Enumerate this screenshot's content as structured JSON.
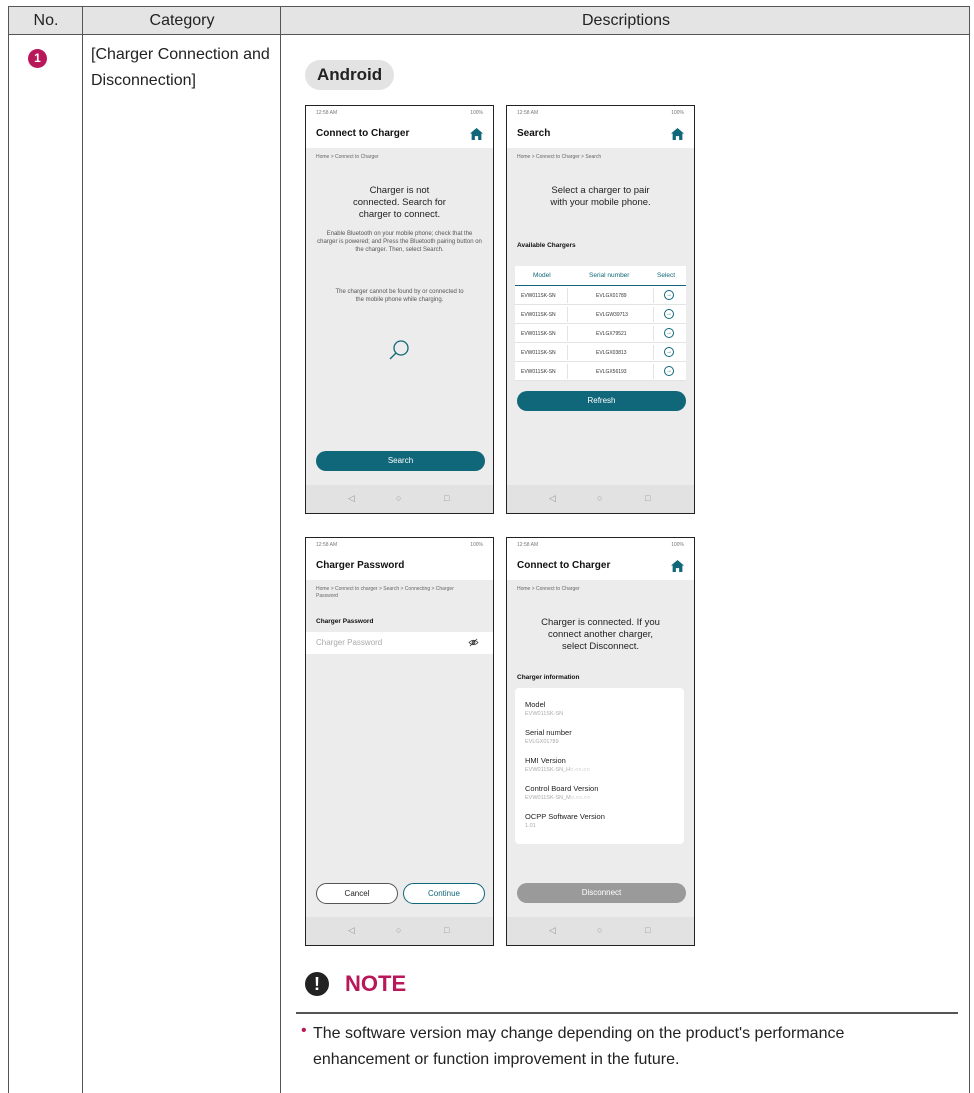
{
  "header": {
    "no": "No.",
    "category": "Category",
    "descriptions": "Descriptions"
  },
  "row": {
    "number": "1",
    "category": "[Charger Connection and Disconnection]",
    "platform": "Android"
  },
  "status": {
    "time": "12:58 AM",
    "battery": "100%"
  },
  "screens": {
    "connect": {
      "title": "Connect to Charger",
      "crumb": "Home > Connect to Charger",
      "message": "Charger is not connected. Search for charger to connect.",
      "instructions": "Enable Bluetooth on your mobile phone; check that the charger is powered; and Press the Bluetooth pairing button on the charger. Then, select Search.",
      "warning": "The charger cannot be found by or connected to the mobile phone while charging.",
      "button": "Search"
    },
    "search": {
      "title": "Search",
      "crumb": "Home > Connect to Charger > Search",
      "message": "Select a charger to pair with your mobile phone.",
      "section": "Available Chargers",
      "columns": [
        "Model",
        "Serial number",
        "Select"
      ],
      "rows": [
        {
          "model": "EVW011SK-SN",
          "serial": "EVLGX01789"
        },
        {
          "model": "EVW011SK-SN",
          "serial": "EVLGW39713"
        },
        {
          "model": "EVW011SK-SN",
          "serial": "EVLGX79521"
        },
        {
          "model": "EVW011SK-SN",
          "serial": "EVLGX03813"
        },
        {
          "model": "EVW011SK-SN",
          "serial": "EVLGX56193"
        }
      ],
      "button": "Refresh"
    },
    "password": {
      "title": "Charger Password",
      "crumb": "Home > Connect to charger > Search > Connecting > Charger Password",
      "section": "Charger Password",
      "placeholder": "Charger Password",
      "cancel": "Cancel",
      "continue": "Continue"
    },
    "connected": {
      "title": "Connect to Charger",
      "crumb": "Home > Connect to Charger",
      "message": "Charger is connected. If you connect another charger, select Disconnect.",
      "section": "Charger information",
      "items": [
        {
          "label": "Model",
          "value": "EVW011SK-SN"
        },
        {
          "label": "Serial number",
          "value": "EVLGX01789"
        },
        {
          "label": "HMI Version",
          "value": "EVW011SK-SN_H○.○○.○○"
        },
        {
          "label": "Control Board Version",
          "value": "EVW011SK-SN_M○.○○.○○"
        },
        {
          "label": "OCPP Software Version",
          "value": "1.01"
        }
      ],
      "button": "Disconnect"
    }
  },
  "note": {
    "icon": "!",
    "title": "NOTE",
    "text": "The software version may change depending on the product's performance enhancement or function improvement in the future."
  },
  "colors": {
    "accent": "#10677a",
    "brand": "#b8185a"
  }
}
